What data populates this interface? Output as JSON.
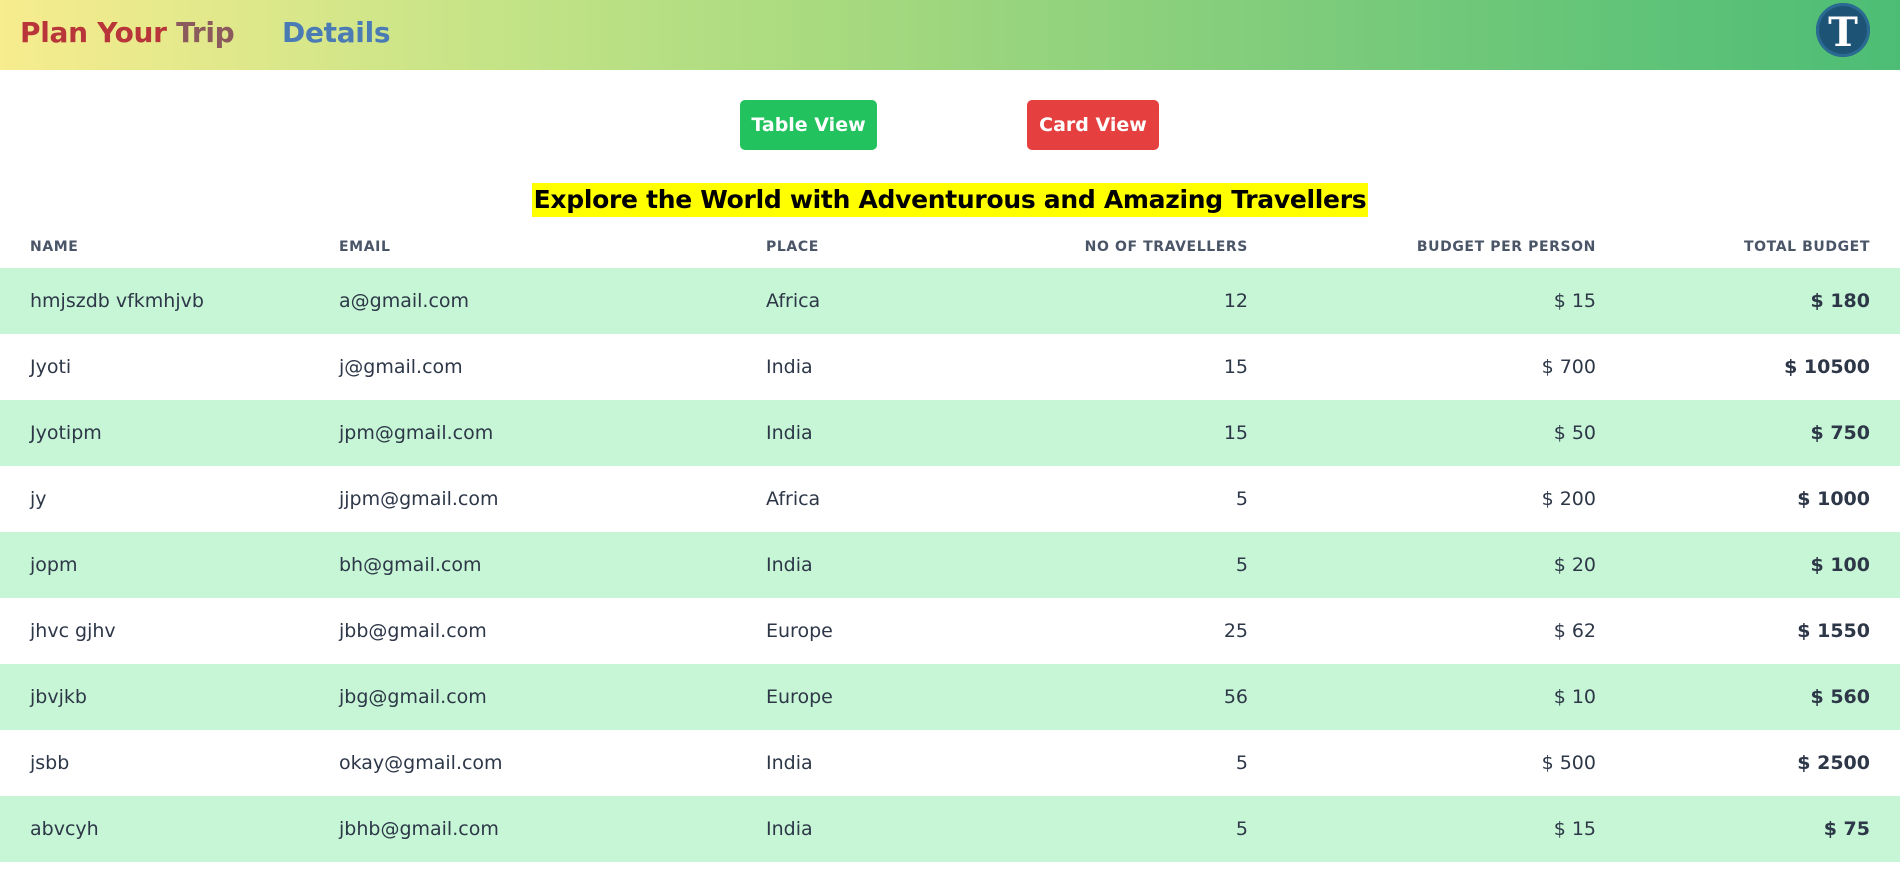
{
  "header": {
    "brand_part1": "Plan Your ",
    "brand_part2": "Trip",
    "details_link": "Details",
    "logo_icon": "t-logo-icon",
    "logo_letter": "T"
  },
  "buttons": {
    "table_view": "Table View",
    "card_view": "Card View"
  },
  "headline": "Explore the World with Adventurous and Amazing Travellers",
  "table": {
    "columns": [
      "Name",
      "Email",
      "Place",
      "No of Travellers",
      "Budget Per Person",
      "Total Budget"
    ],
    "rows": [
      [
        "hmjszdb vfkmhjvb",
        "a@gmail.com",
        "Africa",
        "12",
        "$ 15",
        "$ 180"
      ],
      [
        "Jyoti",
        "j@gmail.com",
        "India",
        "15",
        "$ 700",
        "$ 10500"
      ],
      [
        "Jyotipm",
        "jpm@gmail.com",
        "India",
        "15",
        "$ 50",
        "$ 750"
      ],
      [
        "jy",
        "jjpm@gmail.com",
        "Africa",
        "5",
        "$ 200",
        "$ 1000"
      ],
      [
        "jopm",
        "bh@gmail.com",
        "India",
        "5",
        "$ 20",
        "$ 100"
      ],
      [
        "jhvc gjhv",
        "jbb@gmail.com",
        "Europe",
        "25",
        "$ 62",
        "$ 1550"
      ],
      [
        "jbvjkb",
        "jbg@gmail.com",
        "Europe",
        "56",
        "$ 10",
        "$ 560"
      ],
      [
        "jsbb",
        "okay@gmail.com",
        "India",
        "5",
        "$ 500",
        "$ 2500"
      ],
      [
        "abvcyh",
        "jbhb@gmail.com",
        "India",
        "5",
        "$ 15",
        "$ 75"
      ]
    ]
  },
  "colors": {
    "header_gradient_start": "#f7ec8e",
    "header_gradient_end": "#4dbd75",
    "brand_red": "#b83539",
    "details_blue": "#4a7bb5",
    "table_view_green": "#22c35e",
    "card_view_red": "#e5403f",
    "headline_highlight": "#ffff00",
    "row_stripe": "#c6f6d5"
  }
}
